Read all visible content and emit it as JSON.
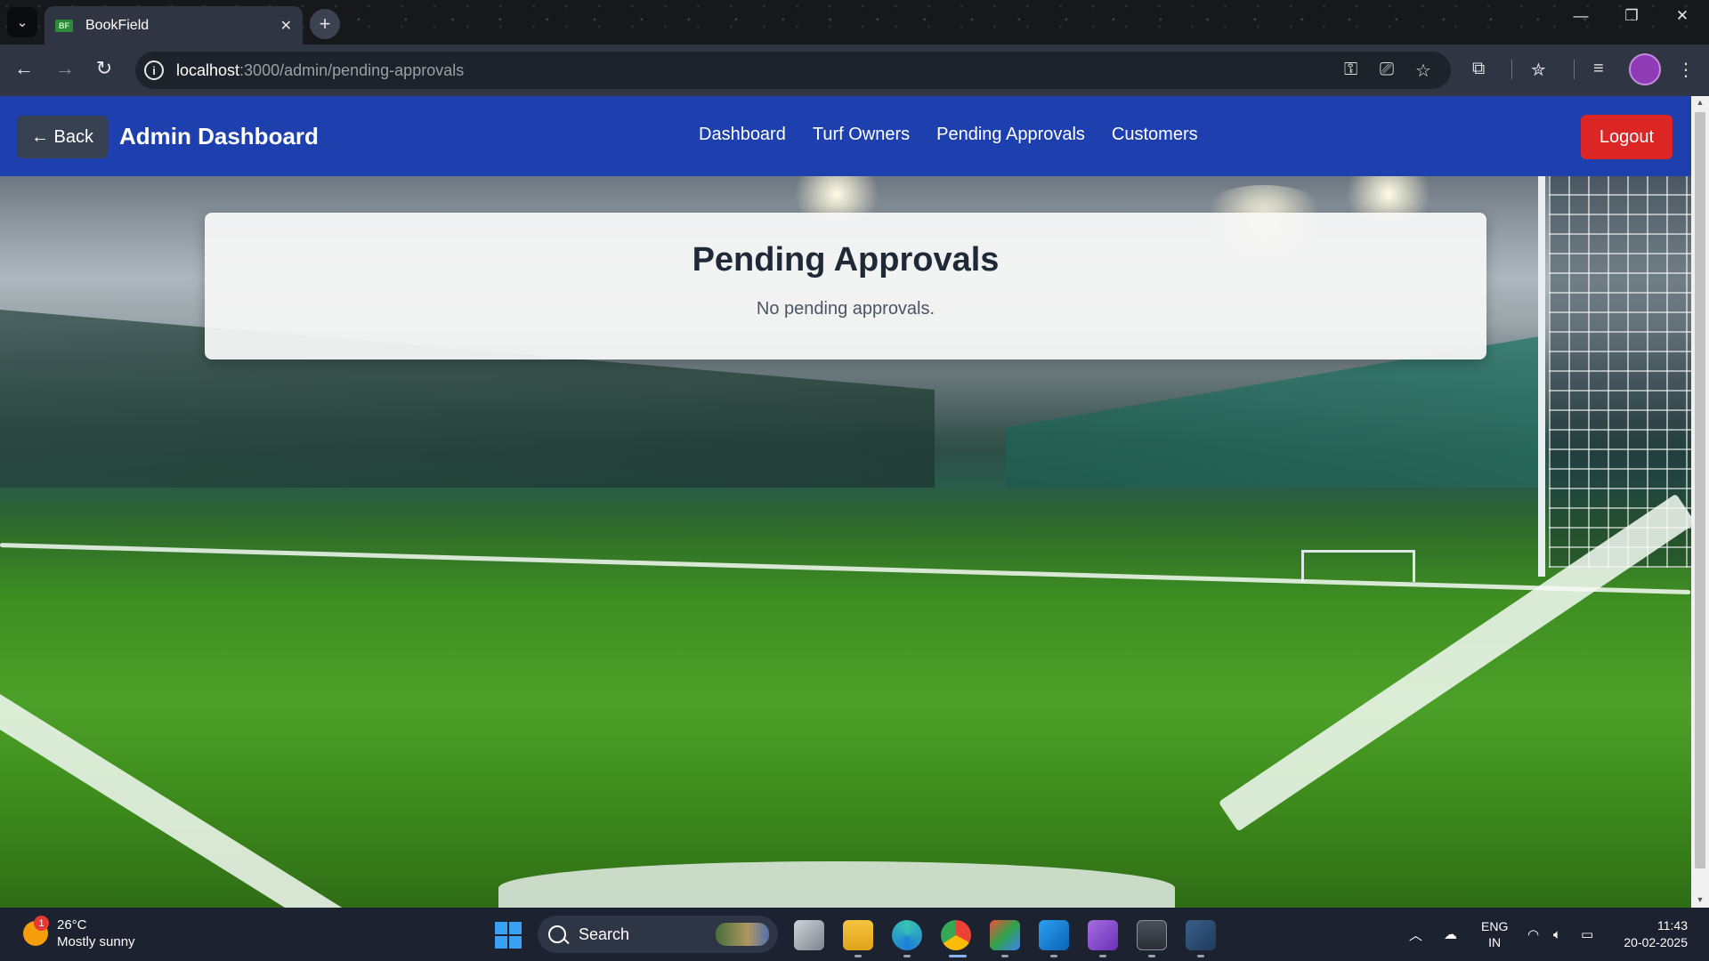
{
  "browser": {
    "tab_title": "BookField",
    "tab_favicon_text": "BF",
    "url_host": "localhost",
    "url_path": ":3000/admin/pending-approvals"
  },
  "app": {
    "back_label": "← Back",
    "brand": "Admin Dashboard",
    "nav": [
      {
        "label": "Dashboard"
      },
      {
        "label": "Turf Owners"
      },
      {
        "label": "Pending Approvals"
      },
      {
        "label": "Customers"
      }
    ],
    "logout_label": "Logout",
    "colors": {
      "navbar": "#1e40af",
      "logout": "#dc2626",
      "back": "#374151"
    }
  },
  "card": {
    "title": "Pending Approvals",
    "message": "No pending approvals."
  },
  "taskbar": {
    "weather_temp": "26°C",
    "weather_desc": "Mostly sunny",
    "weather_badge": "1",
    "search_label": "Search",
    "language_top": "ENG",
    "language_bottom": "IN",
    "time": "11:43",
    "date": "20-02-2025"
  }
}
